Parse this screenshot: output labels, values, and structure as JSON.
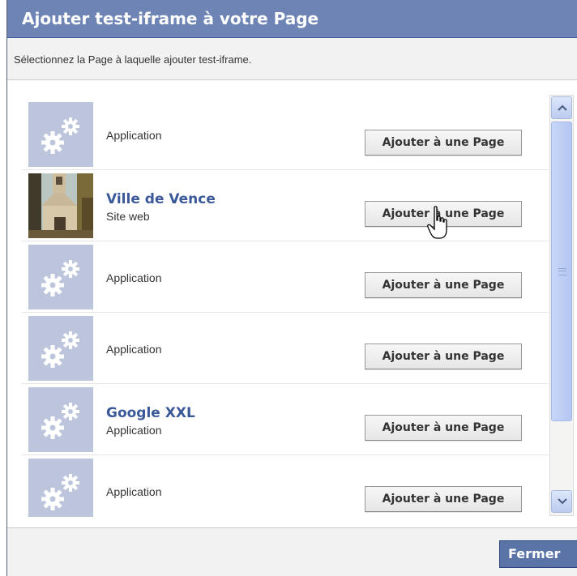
{
  "dialog": {
    "title": "Ajouter test-iframe à votre Page",
    "subtitle": "Sélectionnez la Page à laquelle ajouter test-iframe."
  },
  "items": [
    {
      "name": "",
      "type": "Application",
      "thumb": "gears-icon",
      "button": "Ajouter à une Page"
    },
    {
      "name": "Ville de Vence",
      "type": "Site web",
      "thumb": "chapel-photo",
      "button": "Ajouter à une Page"
    },
    {
      "name": "",
      "type": "Application",
      "thumb": "gears-icon",
      "button": "Ajouter à une Page"
    },
    {
      "name": "",
      "type": "Application",
      "thumb": "gears-icon",
      "button": "Ajouter à une Page"
    },
    {
      "name": "Google XXL",
      "type": "Application",
      "thumb": "gears-icon",
      "button": "Ajouter à une Page"
    },
    {
      "name": "",
      "type": "Application",
      "thumb": "gears-icon",
      "button": "Ajouter à une Page"
    }
  ],
  "footer": {
    "close_label": "Fermer"
  },
  "colors": {
    "title_bar": "#6d84b4",
    "link_blue": "#3b5998",
    "thumb_bg": "#bcc5db",
    "close_button": "#5b74a8"
  }
}
